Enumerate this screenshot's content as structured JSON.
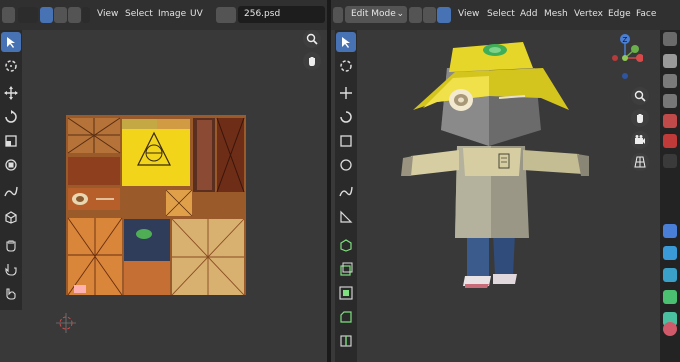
{
  "uv_editor": {
    "menu": [
      "View",
      "Select",
      "Image",
      "UV"
    ],
    "image_name": "256.psd"
  },
  "viewport3d": {
    "mode": "Edit Mode",
    "menu": [
      "View",
      "Select",
      "Add",
      "Mesh",
      "Vertex",
      "Edge",
      "Face"
    ],
    "gizmo": {
      "z": "Z",
      "y": "Y",
      "x": "X"
    }
  },
  "colors": {
    "accent": "#4772b3",
    "hat_yellow": "#e6d62a",
    "coat": "#cfc7a2",
    "pants": "#3b5a8a",
    "texture_orange": "#d98a3c"
  }
}
